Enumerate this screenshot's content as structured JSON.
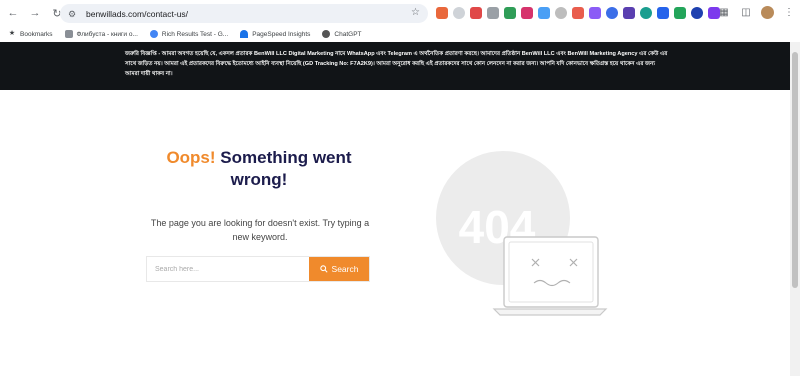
{
  "browser": {
    "url": "benwillads.com/contact-us/",
    "bookmarks": [
      {
        "label": "Bookmarks",
        "icon": "star-icon"
      },
      {
        "label": "Флибуста - книги о...",
        "icon": "book-icon"
      },
      {
        "label": "Rich Results Test - G...",
        "icon": "google-icon"
      },
      {
        "label": "PageSpeed Insights",
        "icon": "speedometer-icon"
      },
      {
        "label": "ChatGPT",
        "icon": "chatgpt-icon"
      }
    ]
  },
  "notice": {
    "text": "জরুরি বিজ্ঞপ্তি - আমরা অবগত হয়েছি যে, একদল প্রতারক BenWill LLC Digital Marketing নামে WhatsApp এবং Telegram এ অর্থনৈতিক প্রতারণা করছে। আমাদের প্রতিষ্ঠান BenWill LLC এবং BenWill Marketing Agency এর কেউ এর সাথে জড়িত নয়। আমরা এই প্রতারকদের বিরুদ্ধে ইতোমধ্যে আইনি ব্যবস্থা নিয়েছি (GD Tracking No: F7A2K9)। আমরা অনুরোধ করছি এই প্রতারকদের সাথে কোন লেনদেন না করার জন্য। আপনি যদি কোনভাবে ক্ষতিগ্রস্ত হয়ে থাকেন এর জন্য আমরা দায়ী থাকব না।"
  },
  "error": {
    "oops": "Oops!",
    "title_rest": " Something went wrong!",
    "message": "The page you are looking for doesn't exist. Try typing a new keyword.",
    "search_placeholder": "Search here...",
    "search_button": "Search",
    "illustration_text": "404"
  },
  "colors": {
    "accent": "#f08a2c",
    "heading": "#1c1c4c",
    "notice_bg": "#111417"
  }
}
